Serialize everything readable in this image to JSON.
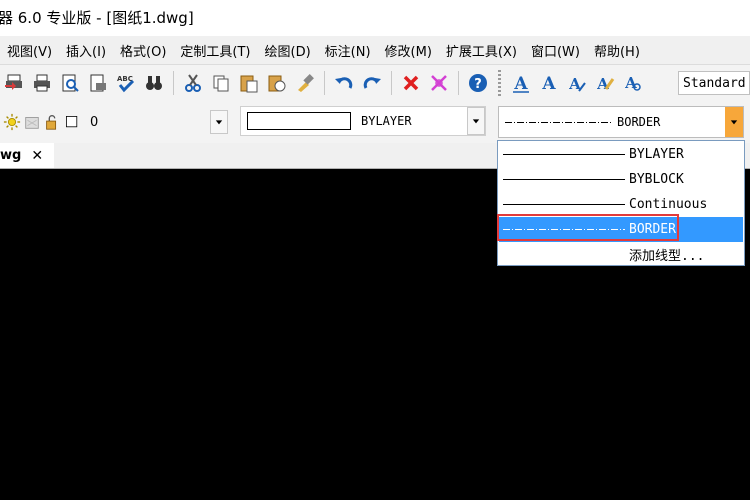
{
  "window": {
    "title": "器 6.0 专业版  - [图纸1.dwg]"
  },
  "menu": [
    "视图(V)",
    "插入(I)",
    "格式(O)",
    "定制工具(T)",
    "绘图(D)",
    "标注(N)",
    "修改(M)",
    "扩展工具(X)",
    "窗口(W)",
    "帮助(H)"
  ],
  "toolbar": {
    "text_style_value": "Standard",
    "icons": [
      "publish-icon",
      "print-icon",
      "print-preview-icon",
      "plot-preview-icon",
      "spell-check-icon",
      "find-icon",
      "cut-icon",
      "copy-icon",
      "paste-icon",
      "paste-special-icon",
      "match-properties-icon",
      "undo-icon",
      "redo-icon",
      "delete-icon",
      "erase-all-icon",
      "help-icon",
      "text-icon",
      "text-outline-icon",
      "text-edit-icon",
      "text-style-icon",
      "find-text-icon"
    ]
  },
  "layer": {
    "current": "0"
  },
  "color": {
    "value": "BYLAYER"
  },
  "linetype": {
    "value": "BORDER",
    "options": [
      {
        "label": "BYLAYER",
        "style": "solid"
      },
      {
        "label": "BYBLOCK",
        "style": "solid"
      },
      {
        "label": "Continuous",
        "style": "solid"
      },
      {
        "label": "BORDER",
        "style": "dashdot",
        "selected": true
      },
      {
        "label": "添加线型...",
        "style": "none"
      }
    ]
  },
  "document_tab": {
    "label": "wg",
    "close_glyph": "✕"
  },
  "colors": {
    "selection": "#3399ff",
    "highlight_box": "#e23b3b",
    "dropdown_button": "#f7a73a",
    "canvas": "#000000"
  }
}
